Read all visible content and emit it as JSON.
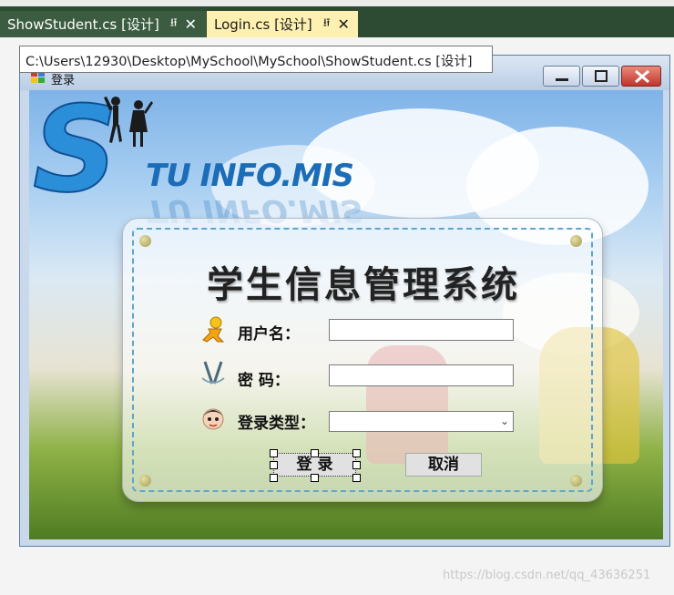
{
  "ide": {
    "tabs": [
      {
        "label": "ShowStudent.cs [设计]",
        "active": false
      },
      {
        "label": "Login.cs [设计]",
        "active": true
      }
    ],
    "tooltip": "C:\\Users\\12930\\Desktop\\MySchool\\MySchool\\ShowStudent.cs [设计]"
  },
  "form": {
    "title": "登录",
    "logo_text": "TU INFO.MIS",
    "logo_letter": "S",
    "system_title": "学生信息管理系统",
    "username_label": "用户名：",
    "password_label": "密  码：",
    "login_type_label": "登录类型：",
    "username_value": "",
    "password_value": "",
    "login_type_value": "",
    "login_button": "登 录",
    "cancel_button": "取消"
  },
  "watermark": "https://blog.csdn.net/qq_43636251",
  "colors": {
    "tab_bar": "#2d4a33",
    "active_tab": "#fdf0b0",
    "logo_blue": "#1c6db8",
    "panel_dash": "#5da5cc"
  }
}
